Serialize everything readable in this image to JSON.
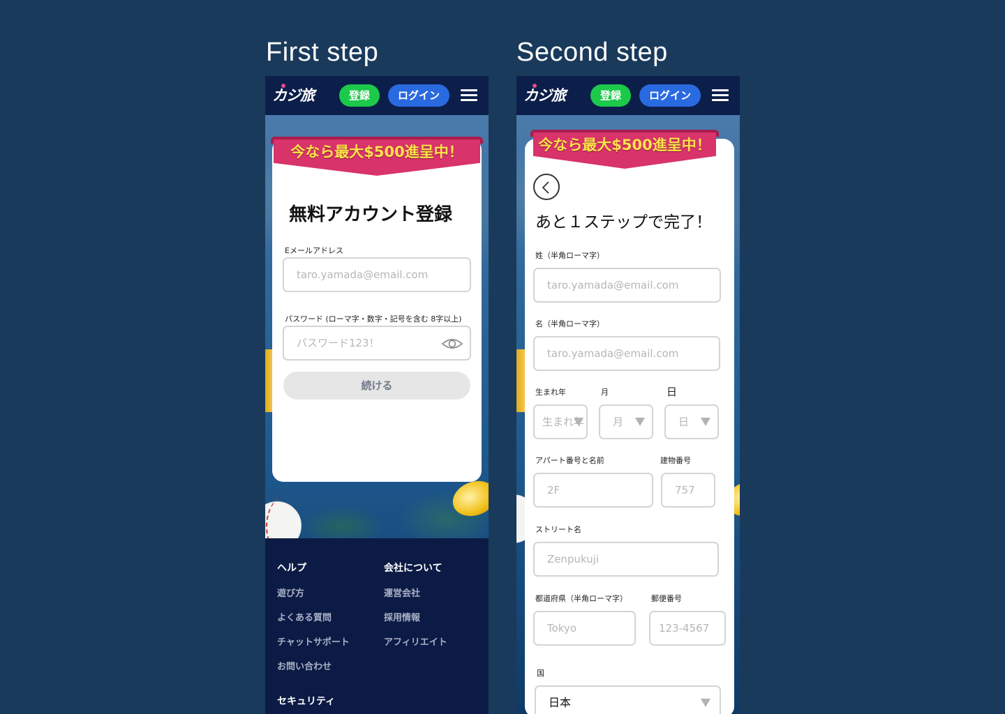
{
  "titles": {
    "step1": "First step",
    "step2": "Second step"
  },
  "header": {
    "logo": "カジ旅",
    "register": "登録",
    "login": "ログイン"
  },
  "banner": {
    "text": "今なら最大$500進呈中！"
  },
  "step1": {
    "heading": "無料アカウント登録",
    "email_label": "Eメールアドレス",
    "email_placeholder": "taro.yamada@email.com",
    "password_label": "パスワード (ローマ字・数字・記号を含む 8字以上)",
    "password_placeholder": "パスワード123！",
    "continue": "続ける"
  },
  "step2": {
    "heading": "あと１ステップで完了！",
    "last_name_label": "姓（半角ローマ字）",
    "last_name_placeholder": "taro.yamada@email.com",
    "first_name_label": "名（半角ローマ字）",
    "first_name_placeholder": "taro.yamada@email.com",
    "birth_year_label": "生まれ年",
    "birth_year_placeholder": "生まれ年",
    "month_label": "月",
    "month_placeholder": "月",
    "day_label": "日",
    "day_placeholder": "日",
    "apartment_label": "アパート番号と名前",
    "apartment_placeholder": "2F",
    "building_label": "建物番号",
    "building_placeholder": "757",
    "street_label": "ストリート名",
    "street_placeholder": "Zenpukuji",
    "prefecture_label": "都道府県（半角ローマ字）",
    "prefecture_placeholder": "Tokyo",
    "postal_label": "郵便番号",
    "postal_placeholder": "123-4567",
    "country_label": "国",
    "country_value": "日本"
  },
  "footer": {
    "help": {
      "heading": "ヘルプ",
      "links": [
        "遊び方",
        "よくある質問",
        "チャットサポート",
        "お問い合わせ"
      ]
    },
    "company": {
      "heading": "会社について",
      "links": [
        "運営会社",
        "採用情報",
        "アフィリエイト"
      ]
    },
    "security": {
      "heading": "セキュリティ"
    }
  },
  "colors": {
    "background": "#1a3a5c",
    "header": "#0c1f4a",
    "register": "#1cc94a",
    "login": "#2a6ae0",
    "ribbon": "#d8336a",
    "ribbon_text": "#ffe24a"
  }
}
